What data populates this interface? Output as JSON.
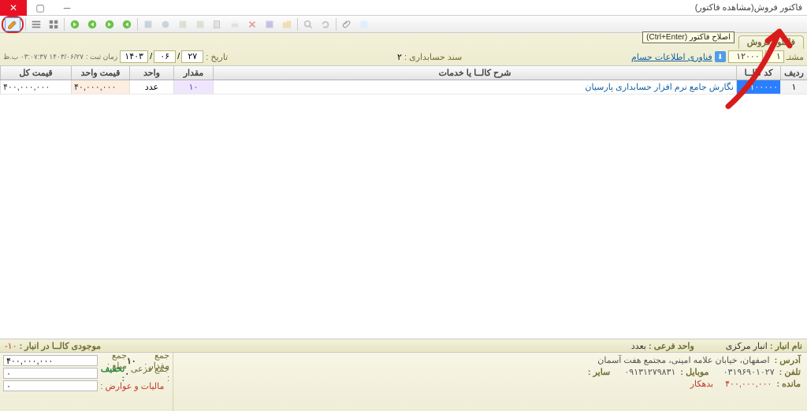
{
  "window": {
    "title": "فاکتور فروش(مشاهده فاکتور)"
  },
  "tooltip": "اصلاح فاکتور (Ctrl+Enter)",
  "tab": {
    "label": "فاکتور فروش"
  },
  "hdr": {
    "customer_lbl": "مشتـ",
    "customer_code": "۱",
    "customer_no": "۱۲۰۰۰",
    "download_lbl": "فناوری اطلاعات حسام",
    "sanad_lbl": "سند حسابداری :",
    "sanad_no": "۲",
    "date_lbl": "تاریخ :",
    "date_d": "۲۷",
    "date_m": "۰۶",
    "date_y": "۱۴۰۳",
    "ts_lbl": "زمان ثبت :",
    "ts_val": "۱۴۰۳/۰۶/۲۷ ۰۳:۰۷:۳۷ ب.ظ"
  },
  "table": {
    "headers": {
      "row": "ردیف",
      "code": "کد کالــا",
      "name": "شرح کالــا یا خدمات",
      "qty": "مقدار",
      "unit": "واحد",
      "uprice": "قیمت واحد",
      "total": "قیمت کل"
    },
    "rows": [
      {
        "row": "۱",
        "code": "۱۰۰۰۰۰",
        "name": "نگارش جامع نرم افزار حسابداری پارسیان",
        "qty": "۱۰",
        "unit": "عدد",
        "uprice": "۴۰,۰۰۰,۰۰۰",
        "total": "۴۰۰,۰۰۰,۰۰۰"
      }
    ]
  },
  "status": {
    "warehouse_lbl": "نام انبار :",
    "warehouse": "انبار مرکزی",
    "subunit_lbl": "واحد فرعی :",
    "subunit": "بعدد",
    "stock_lbl": "موجودی کالــا در انبار :",
    "stock": "۱۰-"
  },
  "totals": {
    "sumqty_lbl": "جمع مقدار :",
    "sumqty": "۱۰",
    "sumamt_lbl": "جمع مبلغ :",
    "sumamt": "۴۰۰,۰۰۰,۰۰۰",
    "discount_lbl": "تخفیف :",
    "discount": "۰",
    "subsum_lbl": "جمع فرعی :",
    "subsum": "۰",
    "tax_lbl": "مالیات و عوارض :",
    "tax": "۰"
  },
  "info": {
    "addr_lbl": "آدرس :",
    "addr": "اصفهان، خیابان علامه امینی، مجتمع هفت آسمان",
    "tel_lbl": "تلفن :",
    "tel": "۰۳۱۹۶۹۰۱۰۲۷",
    "mob_lbl": "موبایل :",
    "mob": "۰۹۱۳۱۲۷۹۸۳۱",
    "other_lbl": "سایر :",
    "bal_lbl": "مانده :",
    "bal": "۴۰۰,۰۰۰,۰۰۰",
    "bal_side": "بدهکار"
  }
}
